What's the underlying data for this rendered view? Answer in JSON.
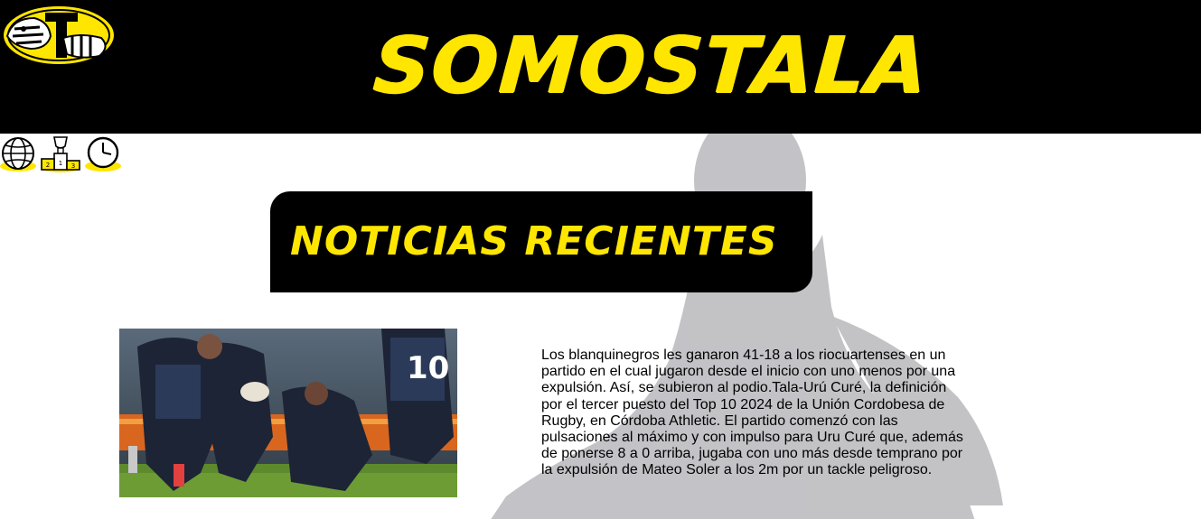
{
  "header": {
    "site_title": "SOMOSTALA",
    "logo_icon": "tala-zebra-logo",
    "background_color": "#000000",
    "accent_color": "#ffe600"
  },
  "nav": {
    "icons": [
      "globe-icon",
      "podium-icon",
      "clock-icon"
    ]
  },
  "section": {
    "title": "NOTICIAS RECIENTES"
  },
  "article": {
    "image_icon": "rugby-match-photo",
    "text": "Los blanquinegros les ganaron 41-18 a los riocuartenses en un partido en el cual jugaron desde el inicio con uno menos por una expulsión. Así, se subieron al podio.Tala-Urú Curé, la definición por el tercer puesto del Top 10 2024 de la Unión Cordobesa de Rugby, en Córdoba Athletic. El partido comenzó con las pulsaciones al máximo y con impulso para Uru Curé que, además de ponerse 8 a 0 arriba, jugaba con uno más desde temprano por la expulsión de Mateo Soler a los 2m por un tackle peligroso."
  }
}
